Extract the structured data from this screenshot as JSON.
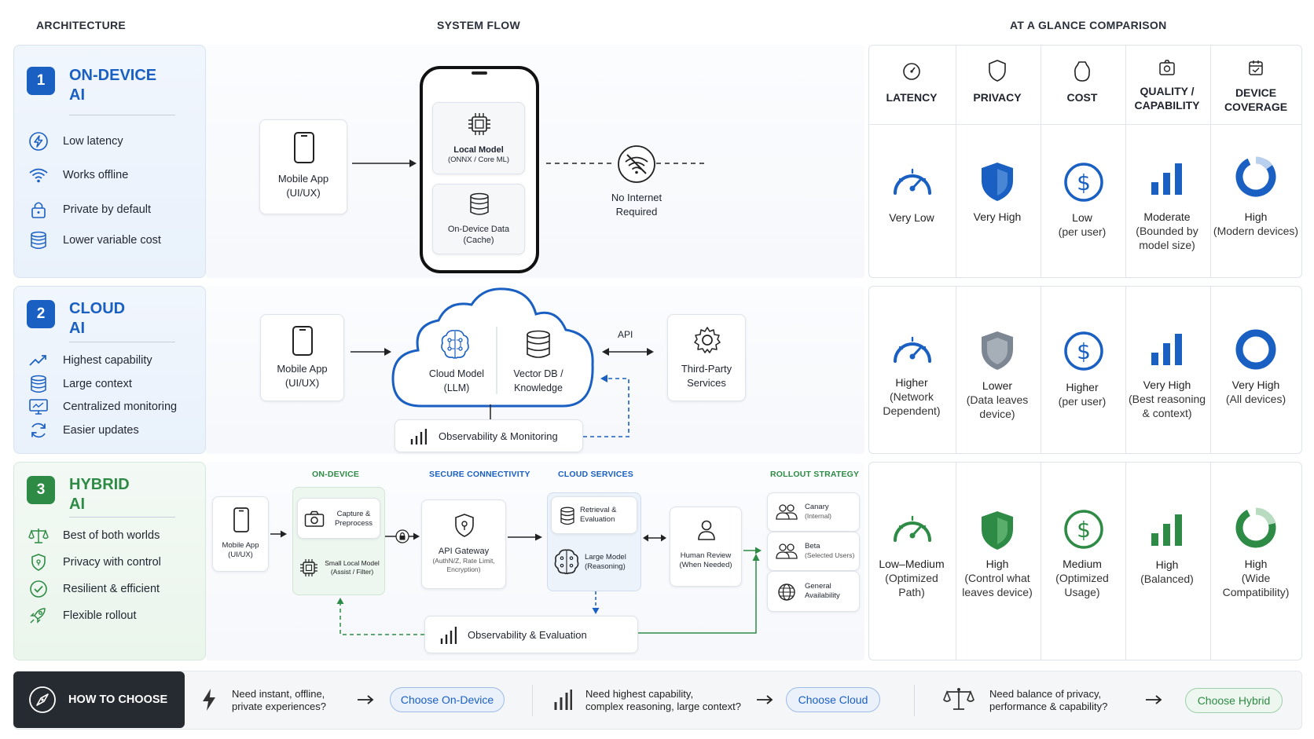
{
  "headers": {
    "architecture": "ARCHITECTURE",
    "system_flow": "SYSTEM FLOW",
    "comparison": "AT A GLANCE COMPARISON"
  },
  "colors": {
    "blue": "#1a5fc2",
    "green": "#2e8b45",
    "gray": "#7d8794",
    "dark": "#262a31"
  },
  "architectures": [
    {
      "number": "1",
      "title_line1": "ON-DEVICE",
      "title_line2": "AI",
      "features": [
        {
          "icon": "lightning-icon",
          "label": "Low latency"
        },
        {
          "icon": "wifi-icon",
          "label": "Works offline"
        },
        {
          "icon": "lock-icon",
          "label": "Private by default"
        },
        {
          "icon": "database-icon",
          "label": "Lower variable cost"
        }
      ]
    },
    {
      "number": "2",
      "title_line1": "CLOUD",
      "title_line2": "AI",
      "features": [
        {
          "icon": "trend-up-icon",
          "label": "Highest capability"
        },
        {
          "icon": "database-icon",
          "label": "Large context"
        },
        {
          "icon": "monitor-icon",
          "label": "Centralized monitoring"
        },
        {
          "icon": "refresh-icon",
          "label": "Easier updates"
        }
      ]
    },
    {
      "number": "3",
      "title_line1": "HYBRID",
      "title_line2": "AI",
      "features": [
        {
          "icon": "scale-icon",
          "label": "Best of both worlds"
        },
        {
          "icon": "shield-icon",
          "label": "Privacy with control"
        },
        {
          "icon": "check-circle-icon",
          "label": "Resilient & efficient"
        },
        {
          "icon": "rocket-icon",
          "label": "Flexible rollout"
        }
      ]
    }
  ],
  "flow_ondevice": {
    "mobile_app_1": "Mobile App",
    "mobile_app_2": "(UI/UX)",
    "local_model_1": "Local Model",
    "local_model_2": "(ONNX / Core ML)",
    "data_1": "On-Device Data",
    "data_2": "(Cache)",
    "no_internet_1": "No Internet",
    "no_internet_2": "Required"
  },
  "flow_cloud": {
    "mobile_app_1": "Mobile App",
    "mobile_app_2": "(UI/UX)",
    "cloud_model_1": "Cloud Model",
    "cloud_model_2": "(LLM)",
    "vector_1": "Vector DB /",
    "vector_2": "Knowledge",
    "api": "API",
    "third_party_1": "Third-Party",
    "third_party_2": "Services",
    "observability": "Observability & Monitoring"
  },
  "flow_hybrid": {
    "sec_ondevice": "ON-DEVICE",
    "sec_connectivity": "SECURE CONNECTIVITY",
    "sec_cloud": "CLOUD SERVICES",
    "sec_rollout": "ROLLOUT STRATEGY",
    "mobile_app_1": "Mobile App",
    "mobile_app_2": "(UI/UX)",
    "capture_1": "Capture &",
    "capture_2": "Preprocess",
    "small_model_1": "Small Local Model",
    "small_model_2": "(Assist / Filter)",
    "gateway_1": "API Gateway",
    "gateway_2": "(AuthN/Z, Rate Limit,",
    "gateway_3": "Encryption)",
    "retrieval_1": "Retrieval &",
    "retrieval_2": "Evaluation",
    "large_model_1": "Large Model",
    "large_model_2": "(Reasoning)",
    "human_1": "Human Review",
    "human_2": "(When Needed)",
    "canary_1": "Canary",
    "canary_2": "(Internal)",
    "beta_1": "Beta",
    "beta_2": "(Selected Users)",
    "ga_1": "General",
    "ga_2": "Availability",
    "observability": "Observability & Evaluation"
  },
  "comparison": {
    "headers": [
      {
        "icon": "gauge-icon",
        "line1": "LATENCY",
        "line2": ""
      },
      {
        "icon": "shield-icon",
        "line1": "PRIVACY",
        "line2": ""
      },
      {
        "icon": "tag-icon",
        "line1": "COST",
        "line2": ""
      },
      {
        "icon": "quality-icon",
        "line1": "QUALITY /",
        "line2": "CAPABILITY"
      },
      {
        "icon": "devices-icon",
        "line1": "DEVICE",
        "line2": "COVERAGE"
      }
    ],
    "rows": [
      [
        {
          "l1": "Very Low",
          "l2": "",
          "l3": ""
        },
        {
          "l1": "Very High",
          "l2": "",
          "l3": ""
        },
        {
          "l1": "Low",
          "l2": "(per user)",
          "l3": ""
        },
        {
          "l1": "Moderate",
          "l2": "(Bounded by",
          "l3": "model size)"
        },
        {
          "l1": "High",
          "l2": "(Modern devices)",
          "l3": ""
        }
      ],
      [
        {
          "l1": "Higher",
          "l2": "(Network",
          "l3": "Dependent)"
        },
        {
          "l1": "Lower",
          "l2": "(Data leaves",
          "l3": "device)"
        },
        {
          "l1": "Higher",
          "l2": "(per user)",
          "l3": ""
        },
        {
          "l1": "Very High",
          "l2": "(Best reasoning",
          "l3": "& context)"
        },
        {
          "l1": "Very High",
          "l2": "(All devices)",
          "l3": ""
        }
      ],
      [
        {
          "l1": "Low–Medium",
          "l2": "(Optimized",
          "l3": "Path)"
        },
        {
          "l1": "High",
          "l2": "(Control what",
          "l3": "leaves device)"
        },
        {
          "l1": "Medium",
          "l2": "(Optimized",
          "l3": "Usage)"
        },
        {
          "l1": "High",
          "l2": "(Balanced)",
          "l3": ""
        },
        {
          "l1": "High",
          "l2": "(Wide",
          "l3": "Compatibility)"
        }
      ]
    ]
  },
  "choose": {
    "title": "HOW TO CHOOSE",
    "items": [
      {
        "icon": "lightning-icon",
        "q1": "Need instant, offline,",
        "q2": "private experiences?",
        "button": "Choose On-Device"
      },
      {
        "icon": "bar-chart-icon",
        "q1": "Need highest capability,",
        "q2": "complex reasoning, large context?",
        "button": "Choose Cloud"
      },
      {
        "icon": "scale-icon",
        "q1": "Need balance of privacy,",
        "q2": "performance & capability?",
        "button": "Choose Hybrid"
      }
    ]
  }
}
